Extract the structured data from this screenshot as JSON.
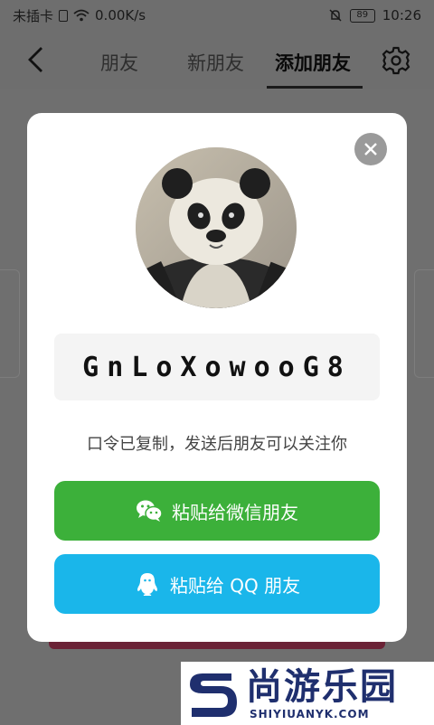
{
  "status_bar": {
    "carrier": "未插卡",
    "speed": "0.00K/s",
    "battery": "89",
    "time": "10:26"
  },
  "nav": {
    "tabs": [
      {
        "label": "朋友",
        "active": false
      },
      {
        "label": "新朋友",
        "active": false
      },
      {
        "label": "添加朋友",
        "active": true
      }
    ]
  },
  "dialog": {
    "invite_code": "GnLoXowooG8",
    "hint": "口令已复制，发送后朋友可以关注你",
    "wechat_button": {
      "label": "粘贴给微信朋友",
      "color": "#3cb03a",
      "icon": "wechat-icon"
    },
    "qq_button": {
      "label": "粘贴给 QQ 朋友",
      "color": "#1ab6ea",
      "icon": "qq-icon"
    },
    "avatar": "panda-avatar"
  },
  "watermark": {
    "title": "尚游乐园",
    "url": "SHIYIUANYK.COM"
  },
  "colors": {
    "overlay": "#6f6f6f",
    "wechat_green": "#3cb03a",
    "qq_blue": "#1ab6ea",
    "watermark_navy": "#1f2f6e"
  }
}
